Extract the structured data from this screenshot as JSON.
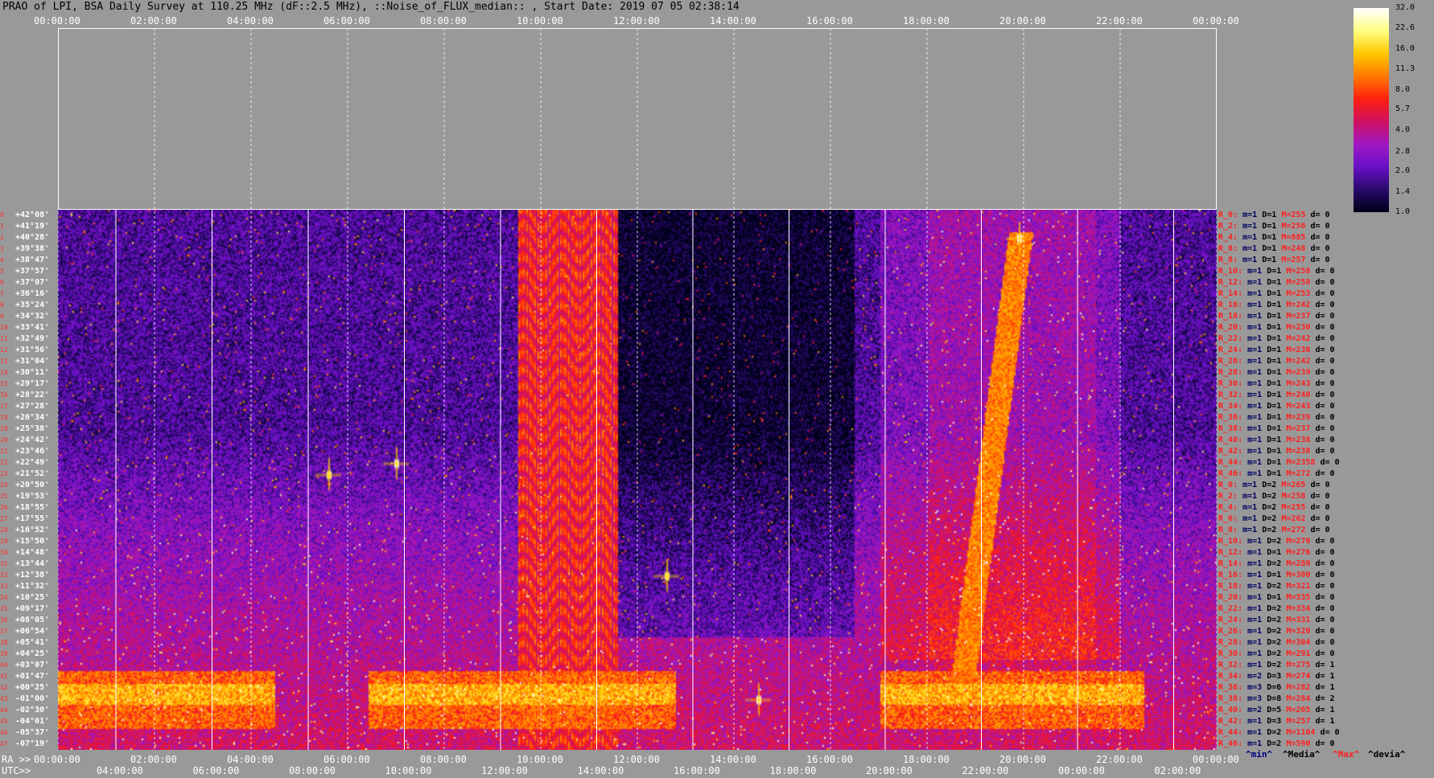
{
  "header": {
    "title": "PRAO of LPI, BSA Daily Survey at 110.25 MHz (dF::2.5 MHz), ::Noise_of_FLUX_median:: , Start Date: 2019 07 05 02:38:14"
  },
  "chart_data": {
    "type": "heatmap",
    "title": "PRAO of LPI, BSA Daily Survey at 110.25 MHz (dF::2.5 MHz), ::Noise_of_FLUX_median:: , Start Date: 2019 07 05 02:38:14",
    "x_top_ticks": [
      "00:00:00",
      "02:00:00",
      "04:00:00",
      "06:00:00",
      "08:00:00",
      "10:00:00",
      "12:00:00",
      "14:00:00",
      "16:00:00",
      "18:00:00",
      "20:00:00",
      "22:00:00",
      "00:00:00"
    ],
    "x_ra_label": "RA >>",
    "x_ra_ticks": [
      "00:00:00",
      "02:00:00",
      "04:00:00",
      "06:00:00",
      "08:00:00",
      "10:00:00",
      "12:00:00",
      "14:00:00",
      "16:00:00",
      "18:00:00",
      "20:00:00",
      "22:00:00",
      "00:00:00"
    ],
    "x_utc_label": "UTC>>",
    "x_utc_ticks": [
      "04:00:00",
      "06:00:00",
      "08:00:00",
      "10:00:00",
      "12:00:00",
      "14:00:00",
      "16:00:00",
      "18:00:00",
      "20:00:00",
      "22:00:00",
      "00:00:00",
      "02:00:00"
    ],
    "declinations": [
      "+42°08'",
      "+41°19'",
      "+40°28'",
      "+39°38'",
      "+38°47'",
      "+37°57'",
      "+37°07'",
      "+36°16'",
      "+35°24'",
      "+34°32'",
      "+33°41'",
      "+32°49'",
      "+31°56'",
      "+31°04'",
      "+30°11'",
      "+29°17'",
      "+28°22'",
      "+27°28'",
      "+26°34'",
      "+25°38'",
      "+24°42'",
      "+23°46'",
      "+22°49'",
      "+21°52'",
      "+20°50'",
      "+19°53'",
      "+18°55'",
      "+17°55'",
      "+16°52'",
      "+15°50'",
      "+14°48'",
      "+13°44'",
      "+12°38'",
      "+11°32'",
      "+10°25'",
      "+09°17'",
      "+08°05'",
      "+06°54'",
      "+05°41'",
      "+04°25'",
      "+03°07'",
      "+01°47'",
      "+00°25'",
      "-01°00'",
      "-02°30'",
      "-04°01'",
      "-05°37'",
      "-07°19'"
    ],
    "row_indices": [
      "0",
      "1",
      "2",
      "3",
      "4",
      "5",
      "6",
      "7",
      "8",
      "9",
      "10",
      "11",
      "12",
      "13",
      "14",
      "15",
      "16",
      "17",
      "18",
      "19",
      "20",
      "21",
      "22",
      "23",
      "24",
      "25",
      "26",
      "27",
      "28",
      "29",
      "30",
      "31",
      "32",
      "33",
      "34",
      "35",
      "36",
      "37",
      "38",
      "39",
      "40",
      "41",
      "42",
      "43",
      "44",
      "45",
      "46",
      "47"
    ],
    "row_stats": [
      {
        "r": "R_0:",
        "m": "m=1",
        "D": "D=1",
        "M": "M=255",
        "d": "d= 0"
      },
      {
        "r": "R_2:",
        "m": "m=1",
        "D": "D=1",
        "M": "M=256",
        "d": "d= 0"
      },
      {
        "r": "R_4:",
        "m": "m=1",
        "D": "D=1",
        "M": "M=885",
        "d": "d= 0"
      },
      {
        "r": "R_6:",
        "m": "m=1",
        "D": "D=1",
        "M": "M=248",
        "d": "d= 0"
      },
      {
        "r": "R_8:",
        "m": "m=1",
        "D": "D=1",
        "M": "M=257",
        "d": "d= 0"
      },
      {
        "r": "R_10:",
        "m": "m=1",
        "D": "D=1",
        "M": "M=258",
        "d": "d= 0"
      },
      {
        "r": "R_12:",
        "m": "m=1",
        "D": "D=1",
        "M": "M=258",
        "d": "d= 0"
      },
      {
        "r": "R_14:",
        "m": "m=1",
        "D": "D=1",
        "M": "M=253",
        "d": "d= 0"
      },
      {
        "r": "R_16:",
        "m": "m=1",
        "D": "D=1",
        "M": "M=242",
        "d": "d= 0"
      },
      {
        "r": "R_18:",
        "m": "m=1",
        "D": "D=1",
        "M": "M=237",
        "d": "d= 0"
      },
      {
        "r": "R_20:",
        "m": "m=1",
        "D": "D=1",
        "M": "M=230",
        "d": "d= 0"
      },
      {
        "r": "R_22:",
        "m": "m=1",
        "D": "D=1",
        "M": "M=242",
        "d": "d= 0"
      },
      {
        "r": "R_24:",
        "m": "m=1",
        "D": "D=1",
        "M": "M=238",
        "d": "d= 0"
      },
      {
        "r": "R_26:",
        "m": "m=1",
        "D": "D=1",
        "M": "M=242",
        "d": "d= 0"
      },
      {
        "r": "R_28:",
        "m": "m=1",
        "D": "D=1",
        "M": "M=239",
        "d": "d= 0"
      },
      {
        "r": "R_30:",
        "m": "m=1",
        "D": "D=1",
        "M": "M=243",
        "d": "d= 0"
      },
      {
        "r": "R_32:",
        "m": "m=1",
        "D": "D=1",
        "M": "M=240",
        "d": "d= 0"
      },
      {
        "r": "R_34:",
        "m": "m=1",
        "D": "D=1",
        "M": "M=243",
        "d": "d= 0"
      },
      {
        "r": "R_36:",
        "m": "m=1",
        "D": "D=1",
        "M": "M=239",
        "d": "d= 0"
      },
      {
        "r": "R_38:",
        "m": "m=1",
        "D": "D=1",
        "M": "M=237",
        "d": "d= 0"
      },
      {
        "r": "R_40:",
        "m": "m=1",
        "D": "D=1",
        "M": "M=238",
        "d": "d= 0"
      },
      {
        "r": "R_42:",
        "m": "m=1",
        "D": "D=1",
        "M": "M=238",
        "d": "d= 0"
      },
      {
        "r": "R_44:",
        "m": "m=1",
        "D": "D=1",
        "M": "M=2358",
        "d": "d= 0"
      },
      {
        "r": "R_46:",
        "m": "m=1",
        "D": "D=1",
        "M": "M=272",
        "d": "d= 0"
      },
      {
        "r": "R_0:",
        "m": "m=1",
        "D": "D=2",
        "M": "M=265",
        "d": "d= 0"
      },
      {
        "r": "R_2:",
        "m": "m=1",
        "D": "D=2",
        "M": "M=258",
        "d": "d= 0"
      },
      {
        "r": "R_4:",
        "m": "m=1",
        "D": "D=2",
        "M": "M=255",
        "d": "d= 0"
      },
      {
        "r": "R_6:",
        "m": "m=1",
        "D": "D=2",
        "M": "M=262",
        "d": "d= 0"
      },
      {
        "r": "R_8:",
        "m": "m=1",
        "D": "D=2",
        "M": "M=272",
        "d": "d= 0"
      },
      {
        "r": "R_10:",
        "m": "m=1",
        "D": "D=2",
        "M": "M=270",
        "d": "d= 0"
      },
      {
        "r": "R_12:",
        "m": "m=1",
        "D": "D=1",
        "M": "M=276",
        "d": "d= 0"
      },
      {
        "r": "R_14:",
        "m": "m=1",
        "D": "D=2",
        "M": "M=289",
        "d": "d= 0"
      },
      {
        "r": "R_16:",
        "m": "m=1",
        "D": "D=1",
        "M": "M=300",
        "d": "d= 0"
      },
      {
        "r": "R_18:",
        "m": "m=1",
        "D": "D=2",
        "M": "M=321",
        "d": "d= 0"
      },
      {
        "r": "R_20:",
        "m": "m=1",
        "D": "D=1",
        "M": "M=335",
        "d": "d= 0"
      },
      {
        "r": "R_22:",
        "m": "m=1",
        "D": "D=2",
        "M": "M=334",
        "d": "d= 0"
      },
      {
        "r": "R_24:",
        "m": "m=1",
        "D": "D=2",
        "M": "M=331",
        "d": "d= 0"
      },
      {
        "r": "R_26:",
        "m": "m=1",
        "D": "D=2",
        "M": "M=320",
        "d": "d= 0"
      },
      {
        "r": "R_28:",
        "m": "m=1",
        "D": "D=2",
        "M": "M=304",
        "d": "d= 0"
      },
      {
        "r": "R_30:",
        "m": "m=1",
        "D": "D=2",
        "M": "M=291",
        "d": "d= 0"
      },
      {
        "r": "R_32:",
        "m": "m=1",
        "D": "D=2",
        "M": "M=275",
        "d": "d= 1"
      },
      {
        "r": "R_34:",
        "m": "m=2",
        "D": "D=3",
        "M": "M=274",
        "d": "d= 1"
      },
      {
        "r": "R_36:",
        "m": "m=3",
        "D": "D=6",
        "M": "M=282",
        "d": "d= 1"
      },
      {
        "r": "R_38:",
        "m": "m=3",
        "D": "D=8",
        "M": "M=284",
        "d": "d= 2"
      },
      {
        "r": "R_40:",
        "m": "m=2",
        "D": "D=5",
        "M": "M=265",
        "d": "d= 1"
      },
      {
        "r": "R_42:",
        "m": "m=1",
        "D": "D=3",
        "M": "M=257",
        "d": "d= 1"
      },
      {
        "r": "R_44:",
        "m": "m=1",
        "D": "D=2",
        "M": "M=1104",
        "d": "d= 0"
      },
      {
        "r": "R_46:",
        "m": "m=1",
        "D": "D=2",
        "M": "M=590",
        "d": "d= 0"
      }
    ],
    "stats_legend": {
      "min": "^min^",
      "median": "^Media^",
      "max": "^Max^",
      "dev": "^devia^"
    },
    "colorbar": {
      "ticks": [
        "32.0",
        "22.6",
        "16.0",
        "11.3",
        "8.0",
        "5.7",
        "4.0",
        "2.8",
        "2.0",
        "1.4",
        "1.0"
      ],
      "range": [
        1.0,
        32.0
      ],
      "scale": "log",
      "colors": [
        "#000018",
        "#2a0a6e",
        "#6a10c8",
        "#a018c0",
        "#d01060",
        "#ff2010",
        "#ff7a00",
        "#ffc800",
        "#ffff80",
        "#ffffff"
      ]
    },
    "features": {
      "background_level": 1.6,
      "galactic_band_rows": [
        41,
        45
      ],
      "galactic_band_level": 9.0,
      "vertical_band_ra_hours": [
        9.5,
        11.6
      ],
      "bright_sources": [
        {
          "ra_h": 19.9,
          "row": 2,
          "level": 32
        },
        {
          "ra_h": 7.0,
          "row": 22,
          "level": 32
        },
        {
          "ra_h": 5.6,
          "row": 23,
          "level": 22
        },
        {
          "ra_h": 12.6,
          "row": 32,
          "level": 22
        },
        {
          "ra_h": 14.5,
          "row": 43,
          "level": 32
        }
      ]
    }
  }
}
